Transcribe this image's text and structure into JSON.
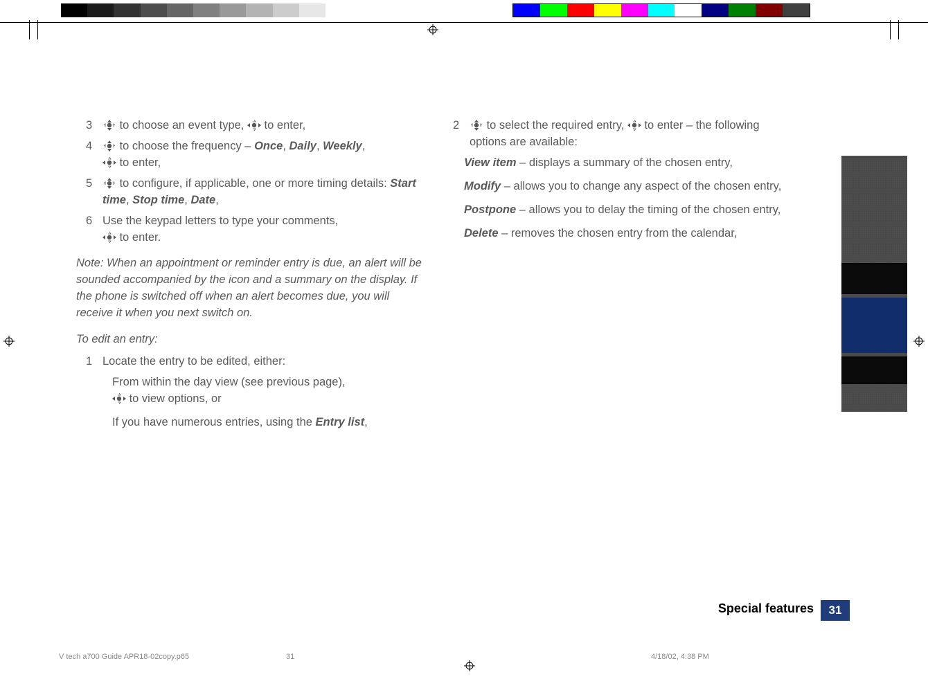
{
  "left": {
    "steps": [
      {
        "n": "3",
        "pre": " to choose an event type, ",
        "post": " to enter,"
      },
      {
        "n": "4",
        "pre": " to choose the frequency – ",
        "opts": [
          "Once",
          "Daily",
          "Weekly"
        ],
        "post2": " to enter,"
      },
      {
        "n": "5",
        "pre": " to configure, if applicable, one or more timing details: ",
        "opts": [
          "Start time",
          "Stop time",
          "Date"
        ],
        "tail": ","
      },
      {
        "n": "6",
        "text": "Use the keypad letters to type your comments, ",
        "post": " to enter."
      }
    ],
    "note": "Note: When an appointment or reminder entry is due, an alert will be sounded accompanied by the icon and a summary on the display. If the phone is switched off when an alert becomes due, you will receive it when you next switch on.",
    "subhead": "To edit an entry:",
    "step1": {
      "n": "1",
      "text": "Locate the entry to be edited, either:"
    },
    "bullet1a": "From within the day view (see previous page), ",
    "bullet1b": " to view options, or",
    "bullet2a": "If you have numerous entries, using the ",
    "bullet2b": "Entry list",
    "bullet2c": ","
  },
  "right": {
    "step2": {
      "n": "2",
      "pre": " to select the required entry, ",
      "post": " to enter – the following options are available:"
    },
    "opts": [
      {
        "label": "View item",
        "text": " – displays a summary of the chosen entry,"
      },
      {
        "label": "Modify",
        "text": " – allows you to change any aspect of the chosen entry,"
      },
      {
        "label": "Postpone",
        "text": " – allows you to delay the timing of the chosen entry,"
      },
      {
        "label": "Delete",
        "text": " – removes the chosen entry from the calendar,"
      }
    ]
  },
  "footer": {
    "section": "Special features",
    "pagenum": "31",
    "file": "V tech a700 Guide APR18-02copy.p65",
    "page": "31",
    "datetime": "4/18/02, 4:38 PM"
  },
  "grays": [
    "#000000",
    "#1a1a1a",
    "#333333",
    "#4d4d4d",
    "#666666",
    "#808080",
    "#999999",
    "#b3b3b3",
    "#cccccc",
    "#e6e6e6",
    "#ffffff"
  ],
  "colors": [
    "#0000ff",
    "#00ff00",
    "#ff0000",
    "#ffff00",
    "#ff00ff",
    "#00ffff",
    "#ffffff",
    "#000080",
    "#008000",
    "#800000",
    "#404040"
  ]
}
